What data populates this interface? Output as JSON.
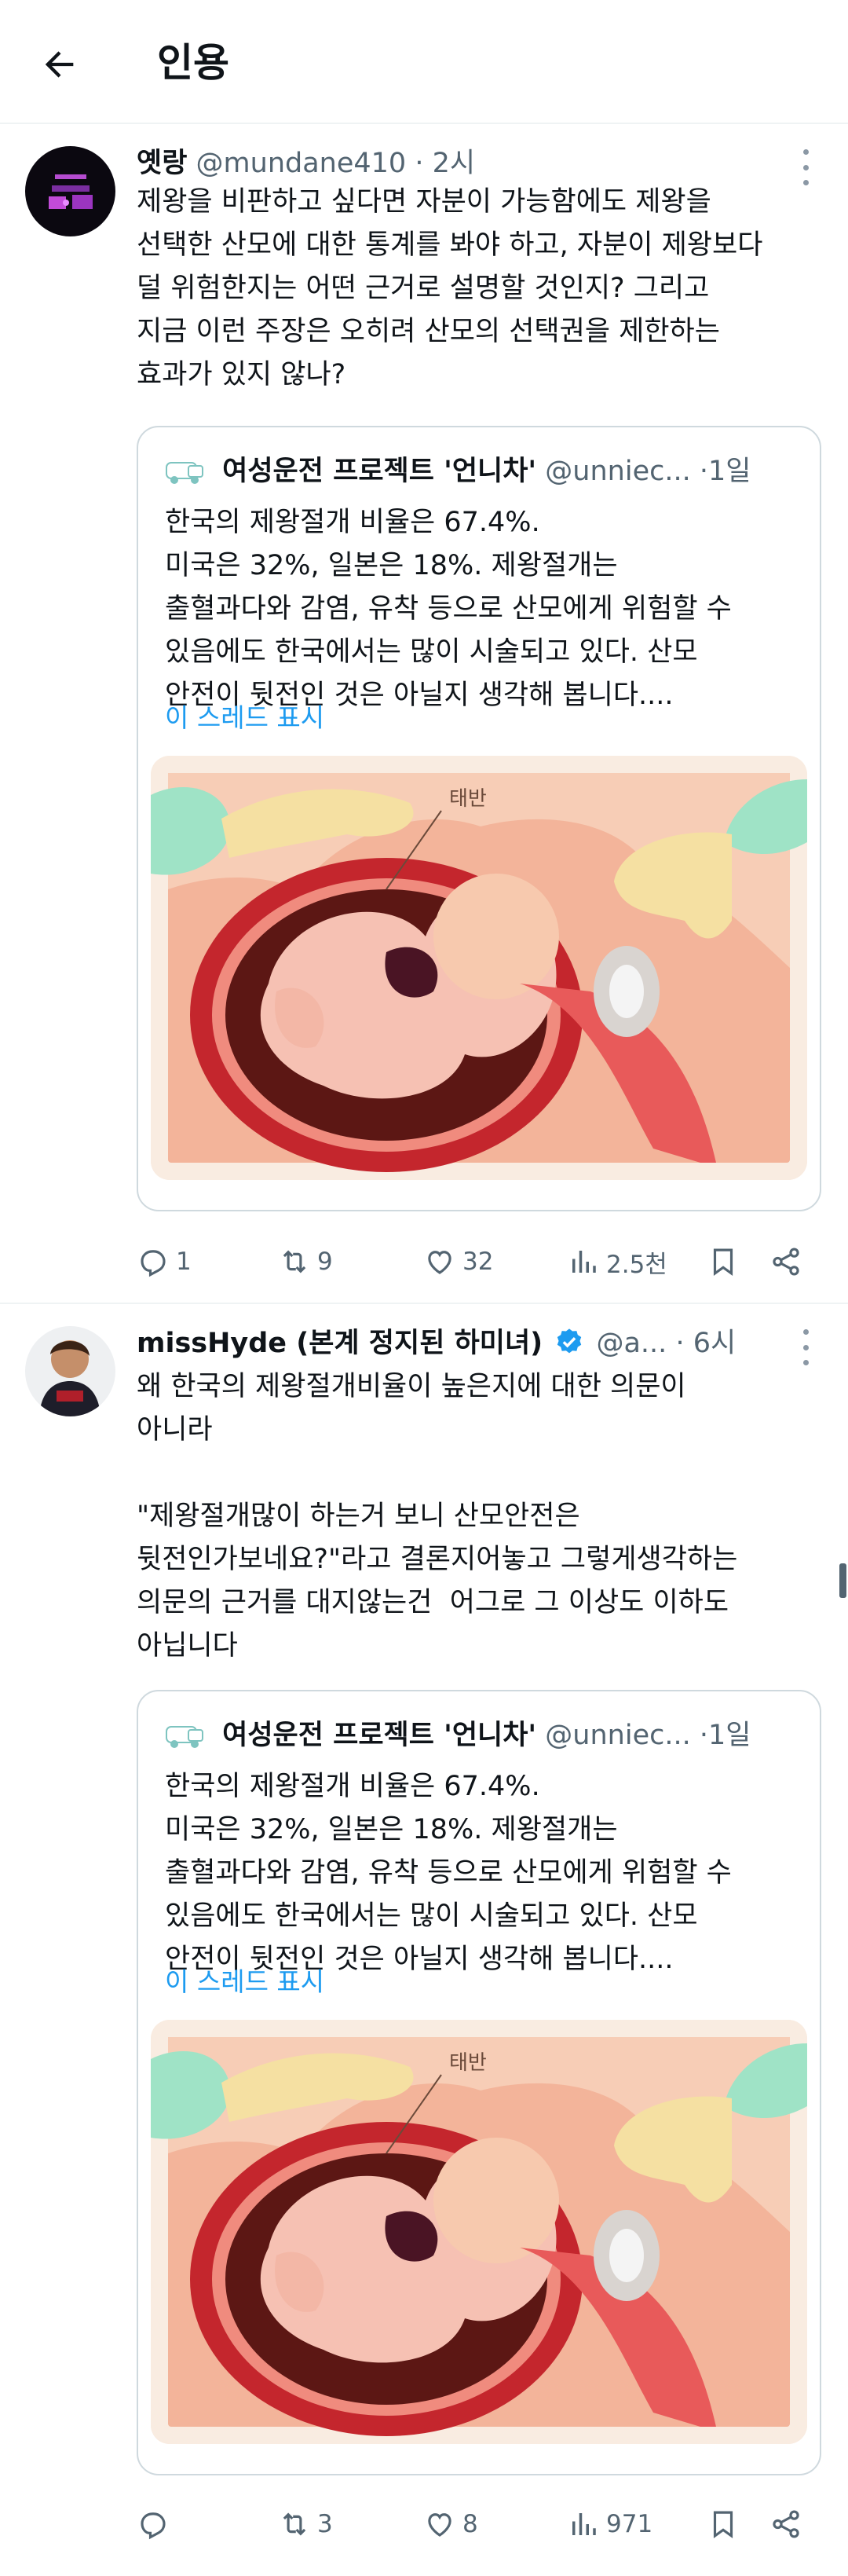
{
  "header": {
    "title": "인용",
    "back_icon": "arrow-left-icon"
  },
  "posts": [
    {
      "name": "옛랑",
      "handle": "@mundane410",
      "dot": "·",
      "time": "2시",
      "verified": false,
      "text": "제왕을 비판하고 싶다면 자분이 가능함에도 제왕을\n선택한 산모에 대한 통계를 봐야 하고, 자분이 제왕보다\n덜 위험한지는 어떤 근거로 설명할 것인지? 그리고\n지금 이런 주장은 오히려 산모의 선택권을 제한하는\n효과가 있지 않나?",
      "quote": {
        "name": "여성운전 프로젝트 '언니차'",
        "handle": "@unniec...",
        "time": "·1일",
        "text": "한국의 제왕절개 비율은 67.4%.\n미국은 32%, 일본은 18%. 제왕절개는\n출혈과다와 감염, 유착 등으로 산모에게 위험할 수\n있음에도 한국에서는 많이 시술되고 있다. 산모\n안전이 뒷전인 것은 아닐지 생각해 봅니다....",
        "show_thread": "이 스레드 표시",
        "image_label": "태반"
      },
      "actions": {
        "replies": "1",
        "reposts": "9",
        "likes": "32",
        "views": "2.5천"
      }
    },
    {
      "name": "missHyde (본계 정지된 하미녀)",
      "handle": "@a...",
      "dot": "·",
      "time": "6시",
      "verified": true,
      "text": "왜 한국의 제왕절개비율이 높은지에 대한 의문이\n아니라\n\n\"제왕절개많이 하는거 보니 산모안전은\n뒷전인가보네요?\"라고 결론지어놓고 그렇게생각하는\n의문의 근거를 대지않는건  어그로 그 이상도 이하도\n아닙니다",
      "quote": {
        "name": "여성운전 프로젝트 '언니차'",
        "handle": "@unniec...",
        "time": "·1일",
        "text": "한국의 제왕절개 비율은 67.4%.\n미국은 32%, 일본은 18%. 제왕절개는\n출혈과다와 감염, 유착 등으로 산모에게 위험할 수\n있음에도 한국에서는 많이 시술되고 있다. 산모\n안전이 뒷전인 것은 아닐지 생각해 봅니다....",
        "show_thread": "이 스레드 표시",
        "image_label": "태반"
      },
      "actions": {
        "replies": "",
        "reposts": "3",
        "likes": "8",
        "views": "971"
      }
    }
  ],
  "colors": {
    "text": "#0f1419",
    "secondary": "#536471",
    "link": "#1d9bf0",
    "border": "#cfd9de",
    "verified": "#1d9bf0"
  },
  "icons": [
    "reply-icon",
    "repost-icon",
    "like-icon",
    "views-icon",
    "bookmark-icon",
    "share-icon",
    "more-icon",
    "verified-badge-icon"
  ]
}
